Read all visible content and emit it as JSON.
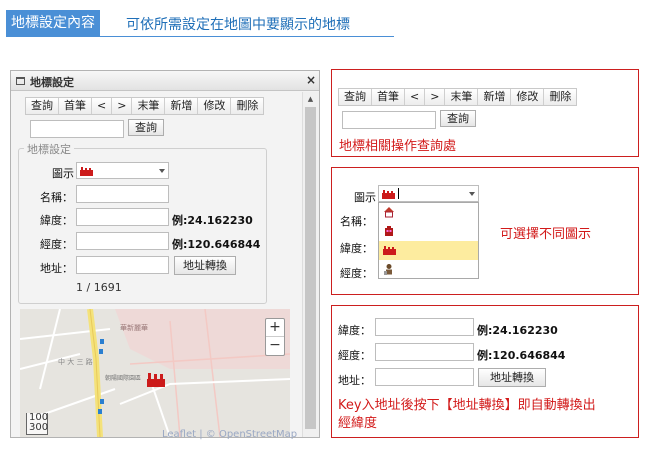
{
  "header": {
    "tag": "地標設定內容",
    "subtitle": "可依所需設定在地圖中要顯示的地標"
  },
  "panel": {
    "title": "地標設定",
    "close": "×",
    "toolbar": [
      "查詢",
      "首筆",
      "<",
      ">",
      "末筆",
      "新增",
      "修改",
      "刪除"
    ],
    "search_button": "查詢",
    "fieldset_legend": "地標設定",
    "icon_label": "圖示",
    "name_label": "名稱：",
    "lat_label": "緯度：",
    "lng_label": "經度：",
    "addr_label": "地址：",
    "lat_example": "例:24.162230",
    "lng_example": "例:120.646844",
    "convert_button": "地址轉換",
    "pager": "1 / 1691"
  },
  "map": {
    "labels": [
      "華新麗華",
      "中 大 三 路",
      "朝陽國際園區"
    ],
    "zoom_in": "+",
    "zoom_out": "−",
    "scale_top": "100",
    "scale_bottom": "300",
    "credit": "Leaflet | © OpenStreetMap"
  },
  "callout_toolbar": {
    "toolbar": [
      "查詢",
      "首筆",
      "<",
      ">",
      "末筆",
      "新增",
      "修改",
      "刪除"
    ],
    "search_button": "查詢",
    "note": "地標相關操作查詢處"
  },
  "callout_icons": {
    "icon_label": "圖示",
    "name_label": "名稱：",
    "lat_label": "緯度：",
    "lng_label": "經度：",
    "options": [
      "house-icon",
      "red-building-icon",
      "factory-icon",
      "worker-icon"
    ],
    "selected_index": 2,
    "note": "可選擇不同圖示"
  },
  "callout_address": {
    "lat_label": "緯度：",
    "lng_label": "經度：",
    "addr_label": "地址：",
    "lat_example": "例:24.162230",
    "lng_example": "例:120.646844",
    "convert_button": "地址轉換",
    "note_line1": "Key入地址後按下【地址轉換】即自動轉換出",
    "note_line2": "經緯度"
  },
  "colors": {
    "accent": "#4a8fd6",
    "callout_border": "#cc1f1f",
    "callout_text": "#d21a1a",
    "marker": "#cc1b1b"
  }
}
